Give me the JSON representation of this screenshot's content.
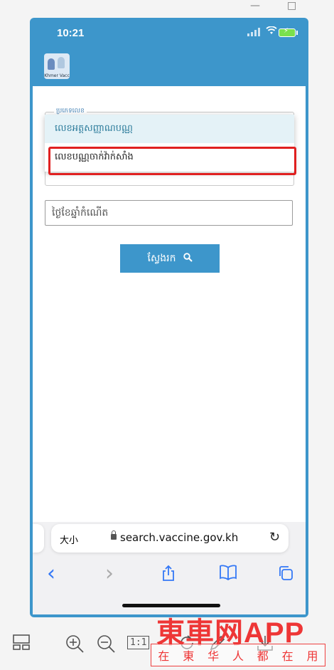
{
  "window": {
    "minimize_glyph": "—",
    "maximize_glyph": "□"
  },
  "status": {
    "time": "10:21",
    "wifi_icon": "wifi-icon",
    "battery_icon": "battery-charging-icon"
  },
  "app": {
    "logo_text": "Khmer Vacc",
    "logo_icon": "app-logo"
  },
  "form": {
    "select_label": "ប្រភេទលេខ",
    "options": [
      "លេខអត្តសញ្ញាណបណ្ណ",
      "លេខបណ្ណចាក់វ៉ាក់សាំង"
    ],
    "dob_placeholder": "ថ្ងៃខែឆ្នាំកំណើត",
    "search_label": "ស្វែងរក",
    "search_icon": "🔍"
  },
  "browser": {
    "text_size_label": "大小",
    "url": "search.vaccine.gov.kh",
    "reload_glyph": "↻",
    "back_glyph": "‹",
    "forward_glyph": "›"
  },
  "viewer_toolbar": {
    "fit_label": "1:1"
  },
  "watermark": {
    "brand": "東車网APP",
    "slogan": [
      "在",
      "東",
      "华",
      "人",
      "都",
      "在",
      "用"
    ]
  },
  "colors": {
    "accent": "#3d96cb",
    "highlight": "#e02020",
    "watermark": "#ee3636"
  }
}
